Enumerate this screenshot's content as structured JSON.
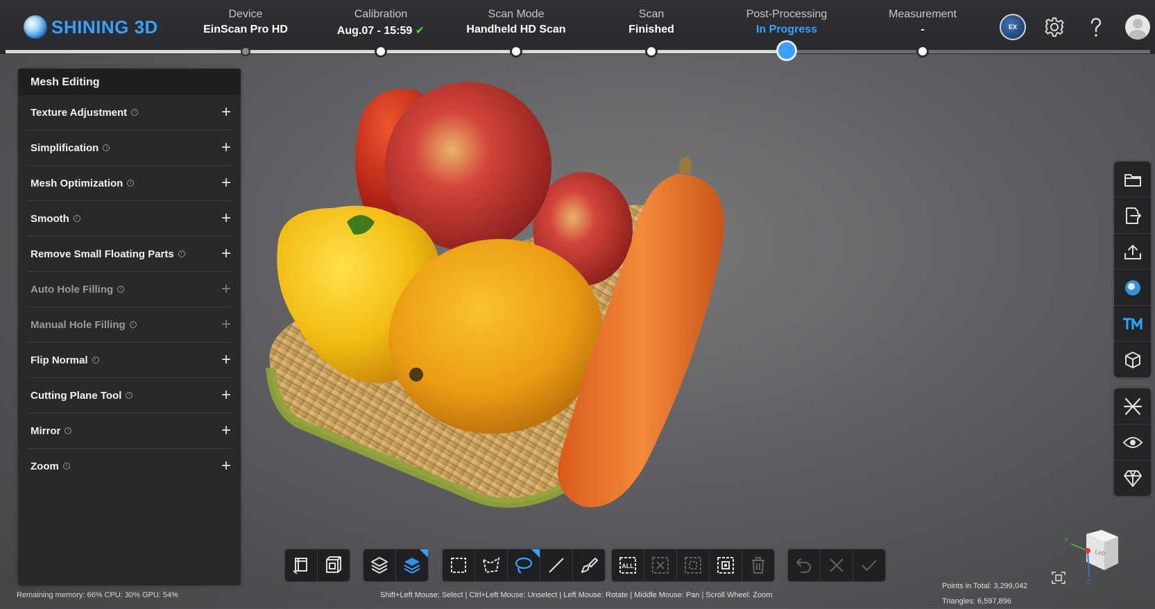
{
  "app": {
    "logo_text": "SHINING 3D"
  },
  "steps": [
    {
      "label": "Device",
      "value": "EinScan Pro HD",
      "state": "done"
    },
    {
      "label": "Calibration",
      "value": "Aug.07 - 15:59",
      "check": "✔",
      "state": "done"
    },
    {
      "label": "Scan Mode",
      "value": "Handheld HD Scan",
      "state": "done"
    },
    {
      "label": "Scan",
      "value": "Finished",
      "state": "done"
    },
    {
      "label": "Post-Processing",
      "value": "In Progress",
      "state": "current"
    },
    {
      "label": "Measurement",
      "value": "-",
      "state": "pending"
    }
  ],
  "top_icons": {
    "ex_mode": "EX Mode",
    "settings": "gear-icon",
    "help": "help-icon",
    "user": "avatar"
  },
  "panel": {
    "title": "Mesh Editing",
    "items": [
      {
        "label": "Texture Adjustment",
        "enabled": true
      },
      {
        "label": "Simplification",
        "enabled": true
      },
      {
        "label": "Mesh Optimization",
        "enabled": true
      },
      {
        "label": "Smooth",
        "enabled": true
      },
      {
        "label": "Remove Small Floating Parts",
        "enabled": true
      },
      {
        "label": "Auto Hole Filling",
        "enabled": false
      },
      {
        "label": "Manual Hole Filling",
        "enabled": false
      },
      {
        "label": "Flip Normal",
        "enabled": true
      },
      {
        "label": "Cutting Plane Tool",
        "enabled": true
      },
      {
        "label": "Mirror",
        "enabled": true
      },
      {
        "label": "Zoom",
        "enabled": true
      }
    ],
    "info_glyph": "i",
    "plus_glyph": "+"
  },
  "right_toolbar": {
    "group1": [
      "folder-icon",
      "export-file-icon",
      "upload-icon",
      "sketchfab-icon",
      "tm-icon",
      "cube-icon"
    ],
    "group2": [
      "align-icon",
      "eye-icon",
      "gem-icon"
    ]
  },
  "bottom_toolbar": {
    "groups": [
      [
        "view-front-icon",
        "view-box-icon"
      ],
      [
        "layers-icon",
        "layers-selected-icon"
      ],
      [
        "rect-select-icon",
        "polygon-select-icon",
        "lasso-select-icon",
        "line-select-icon",
        "brush-select-icon"
      ],
      [
        "select-all-icon",
        "clear-selection-icon",
        "invert-selection-icon",
        "select-connected-icon",
        "delete-icon"
      ],
      [
        "undo-icon",
        "cancel-icon",
        "apply-icon"
      ]
    ],
    "select_all_text": "ALL"
  },
  "status": {
    "resources": "Remaining memory: 66% CPU: 30% GPU: 54%",
    "hint": "Shift+Left Mouse: Select | Ctrl+Left Mouse: Unselect | Left Mouse: Rotate | Middle Mouse: Pan | Scroll Wheel: Zoom",
    "points": "Points in Total: 3,299,042",
    "triangles": "Triangles: 6,597,896"
  },
  "nav_cube": {
    "face_label": "Left",
    "axis_y": "Y",
    "axis_z": "Z"
  },
  "colors": {
    "accent": "#3aa0ff",
    "check": "#4fd04f",
    "panel_bg": "#28292b",
    "topbar_bg": "#2d2e31"
  }
}
